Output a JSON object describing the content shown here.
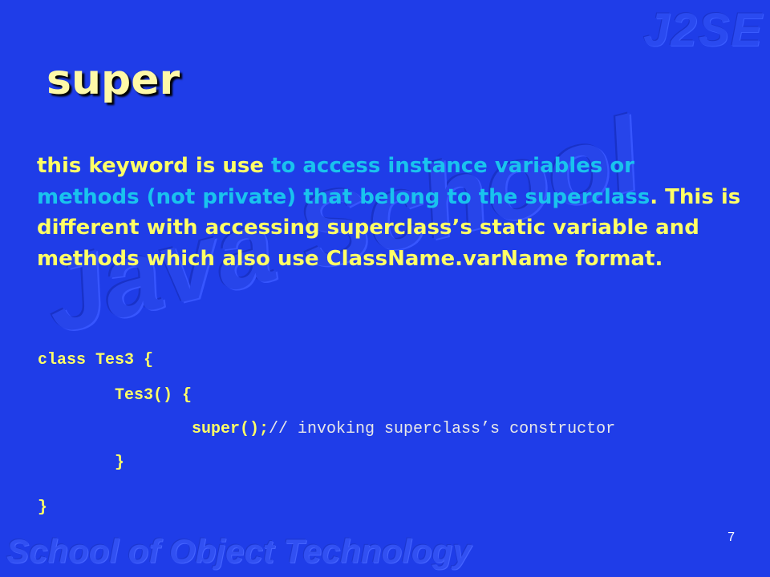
{
  "watermarks": {
    "corner": "J2SE",
    "center": "Java School",
    "bottom": "School of Object Technology"
  },
  "slide": {
    "title": "super",
    "paragraph": {
      "part1": "this keyword is use ",
      "part2": "to access instance variables or methods (not private) that belong to the superclass",
      "part3": ". This is different with accessing superclass’s static variable and methods which also use ClassName.varName format."
    },
    "code": {
      "line1": "class Tes3 {",
      "line2": "Tes3() {",
      "line3_code": "super();",
      "line3_comment": "// invoking superclass’s constructor",
      "line4": "}",
      "line5": "}"
    },
    "page_number": "7"
  },
  "colors": {
    "background": "#1f3de8",
    "title": "#fff9a8",
    "text": "#ffff66",
    "highlight": "#19c3ee"
  }
}
